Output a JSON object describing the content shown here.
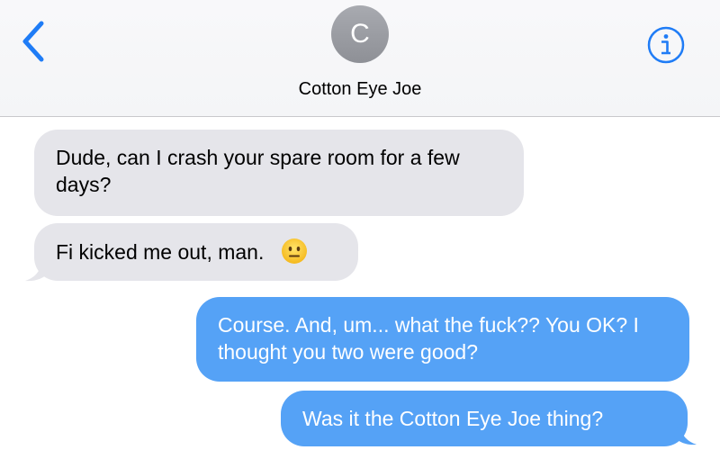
{
  "header": {
    "avatar_initial": "C",
    "contact_name": "Cotton Eye Joe",
    "back_icon": "chevron-left-icon",
    "info_icon": "info-icon"
  },
  "messages": [
    {
      "direction": "incoming",
      "text": "Dude, can I crash your spare room for a few days?"
    },
    {
      "direction": "incoming",
      "text": "Fi kicked me out, man.",
      "emoji": "neutral-face-emoji"
    },
    {
      "direction": "outgoing",
      "text": "Course. And, um... what the fuck?? You OK? I thought you two were good?"
    },
    {
      "direction": "outgoing",
      "text": "Was it the Cotton Eye Joe thing?"
    }
  ],
  "colors": {
    "accent": "#1f7cf6",
    "incoming_bubble": "#e5e5ea",
    "outgoing_bubble": "#55a2f6",
    "avatar": "#9a9ca2"
  }
}
